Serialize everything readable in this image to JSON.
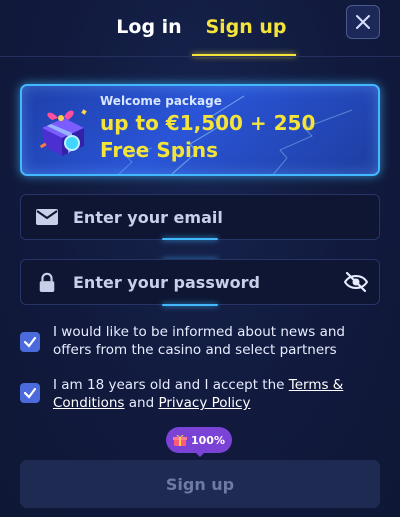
{
  "tabs": {
    "login": "Log in",
    "signup": "Sign up"
  },
  "banner": {
    "eyebrow": "Welcome package",
    "headline": "up to €1,500 + 250 Free Spins"
  },
  "email": {
    "placeholder": "Enter your email",
    "value": ""
  },
  "password": {
    "placeholder": "Enter your password",
    "value": ""
  },
  "consent": {
    "news": {
      "text": "I would like to be informed about news and offers from the casino and select partners",
      "checked": true
    },
    "age": {
      "prefix": "I am 18 years old and I accept the ",
      "terms_link": "Terms & Conditions",
      "and": " and ",
      "privacy_link": "Privacy Policy",
      "checked": true
    }
  },
  "progress_badge": {
    "label": "100%",
    "value": 100
  },
  "submit": {
    "label": "Sign up"
  },
  "colors": {
    "accent": "#f4e43a",
    "border_glow": "#41b8ff",
    "checkbox": "#4b6bdc",
    "badge": "#7a43d6"
  },
  "icons": [
    "close-icon",
    "gift-icon",
    "envelope-icon",
    "lock-icon",
    "eye-off-icon",
    "checkmark-icon",
    "gift-badge-icon"
  ]
}
